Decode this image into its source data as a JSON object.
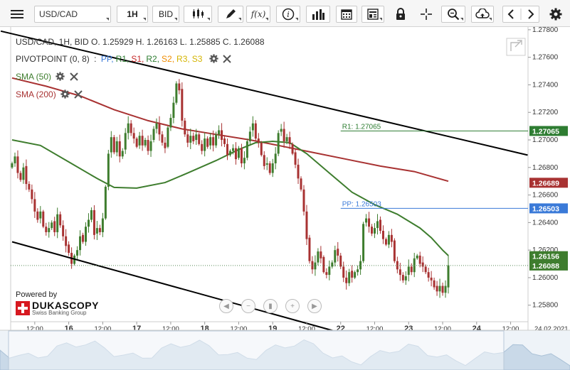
{
  "toolbar": {
    "symbol": "USD/CAD",
    "interval": "1H",
    "side": "BID",
    "fx_label": "f(x)",
    "buttons": [
      "menu-icon",
      "candle-type-icon",
      "draw-pen-icon",
      "function-icon",
      "info-icon",
      "bar-chart-icon",
      "calendar-icon",
      "news-icon",
      "lock-icon",
      "crosshair-icon",
      "zoom-icon",
      "upload-icon",
      "arrow-left-icon",
      "arrow-right-icon",
      "gear-icon"
    ]
  },
  "legend": {
    "ohlc": "USD/CAD, 1H, BID   O. 1.25929 H. 1.26163 L. 1.25885 C. 1.26088",
    "pivot": {
      "name": "PIVOTPOINT (0, 8)",
      "colon": ":",
      "items": [
        {
          "label": "PP",
          "color": "#3a7ad8"
        },
        {
          "label": "R1",
          "color": "#2e7d32"
        },
        {
          "label": "S1",
          "color": "#c62828"
        },
        {
          "label": "R2",
          "color": "#2e7d32"
        },
        {
          "label": "S2",
          "color": "#f08c00"
        },
        {
          "label": "R3",
          "color": "#d4b400"
        },
        {
          "label": "S3",
          "color": "#d4b400"
        }
      ]
    },
    "sma50": {
      "label": "SMA (50)",
      "color": "#3e7d2e"
    },
    "sma200": {
      "label": "SMA (200)",
      "color": "#a83232"
    }
  },
  "branding": {
    "powered_by": "Powered by",
    "name": "DUKASCOPY",
    "tagline": "Swiss Banking Group"
  },
  "chart_data": {
    "type": "candlestick",
    "instrument": "USD/CAD",
    "timeframe": "1H",
    "ohlc_last": {
      "open": 1.25929,
      "high": 1.26163,
      "low": 1.25885,
      "close": 1.26088
    },
    "ylim": [
      1.2568,
      1.2782
    ],
    "y_ticks": [
      "1.27800",
      "1.27600",
      "1.27400",
      "1.27200",
      "1.27000",
      "1.26800",
      "1.26600",
      "1.26400",
      "1.26200",
      "1.26000",
      "1.25800"
    ],
    "x_ticks": [
      {
        "label": "12:00",
        "bar": 8
      },
      {
        "label": "16",
        "bar": 20
      },
      {
        "label": "12:00",
        "bar": 32
      },
      {
        "label": "17",
        "bar": 44
      },
      {
        "label": "12:00",
        "bar": 56
      },
      {
        "label": "18",
        "bar": 68
      },
      {
        "label": "12:00",
        "bar": 80
      },
      {
        "label": "19",
        "bar": 92
      },
      {
        "label": "12:00",
        "bar": 104
      },
      {
        "label": "22",
        "bar": 116
      },
      {
        "label": "12:00",
        "bar": 128
      },
      {
        "label": "23",
        "bar": 140
      },
      {
        "label": "12:00",
        "bar": 152
      },
      {
        "label": "24",
        "bar": 164
      },
      {
        "label": "12:00",
        "bar": 176
      }
    ],
    "x_end_label": "24.02.2021",
    "closes": [
      1.2683,
      1.2688,
      1.2676,
      1.2671,
      1.268,
      1.2668,
      1.2664,
      1.2657,
      1.2648,
      1.2642,
      1.2648,
      1.2637,
      1.2633,
      1.2636,
      1.264,
      1.2633,
      1.2646,
      1.2638,
      1.263,
      1.2623,
      1.2618,
      1.261,
      1.2616,
      1.262,
      1.263,
      1.2626,
      1.2637,
      1.2642,
      1.2649,
      1.2631,
      1.2636,
      1.2633,
      1.2643,
      1.2666,
      1.269,
      1.2702,
      1.2691,
      1.2699,
      1.2688,
      1.2692,
      1.2705,
      1.2712,
      1.2705,
      1.2701,
      1.2695,
      1.2703,
      1.2696,
      1.27,
      1.2692,
      1.2699,
      1.2708,
      1.2712,
      1.2704,
      1.2698,
      1.2694,
      1.2709,
      1.2716,
      1.2727,
      1.2741,
      1.2736,
      1.2714,
      1.2704,
      1.2698,
      1.2703,
      1.2699,
      1.2704,
      1.2697,
      1.2692,
      1.2701,
      1.2695,
      1.2702,
      1.2696,
      1.2704,
      1.2707,
      1.27,
      1.2697,
      1.2689,
      1.2692,
      1.2694,
      1.2686,
      1.2694,
      1.2683,
      1.2687,
      1.2699,
      1.2706,
      1.2712,
      1.2701,
      1.2698,
      1.2689,
      1.2681,
      1.2683,
      1.2676,
      1.2683,
      1.269,
      1.2705,
      1.2708,
      1.2699,
      1.2702,
      1.2697,
      1.269,
      1.2682,
      1.2672,
      1.2664,
      1.2648,
      1.2628,
      1.2612,
      1.2606,
      1.2611,
      1.2619,
      1.2614,
      1.2604,
      1.2602,
      1.2608,
      1.2611,
      1.262,
      1.2616,
      1.2608,
      1.26,
      1.2596,
      1.2604,
      1.26,
      1.2604,
      1.2606,
      1.2612,
      1.2639,
      1.2643,
      1.2637,
      1.2632,
      1.2636,
      1.2641,
      1.2634,
      1.2628,
      1.2624,
      1.2631,
      1.2626,
      1.2612,
      1.2606,
      1.2602,
      1.2598,
      1.2601,
      1.2608,
      1.2604,
      1.2614,
      1.2616,
      1.261,
      1.2608,
      1.2604,
      1.26,
      1.2598,
      1.2593,
      1.259,
      1.2594,
      1.2589,
      1.2594,
      1.2609
    ],
    "sma50": [
      [
        0,
        1.27
      ],
      [
        10,
        1.2696
      ],
      [
        20,
        1.2684
      ],
      [
        30,
        1.2672
      ],
      [
        36,
        1.26655
      ],
      [
        44,
        1.2665
      ],
      [
        54,
        1.2669
      ],
      [
        62,
        1.2676
      ],
      [
        72,
        1.2685
      ],
      [
        80,
        1.2693
      ],
      [
        86,
        1.2698
      ],
      [
        92,
        1.2699
      ],
      [
        98,
        1.2698
      ],
      [
        104,
        1.269
      ],
      [
        112,
        1.2676
      ],
      [
        120,
        1.2662
      ],
      [
        128,
        1.2653
      ],
      [
        136,
        1.2646
      ],
      [
        144,
        1.2636
      ],
      [
        148,
        1.2629
      ],
      [
        152,
        1.262
      ],
      [
        154,
        1.2616
      ]
    ],
    "sma200": [
      [
        0,
        1.2745
      ],
      [
        12,
        1.2739
      ],
      [
        24,
        1.2732
      ],
      [
        36,
        1.2722
      ],
      [
        48,
        1.2714
      ],
      [
        60,
        1.2708
      ],
      [
        72,
        1.2704
      ],
      [
        84,
        1.27
      ],
      [
        94,
        1.2696
      ],
      [
        106,
        1.2691
      ],
      [
        118,
        1.2686
      ],
      [
        130,
        1.2681
      ],
      [
        142,
        1.2677
      ],
      [
        154,
        1.267
      ]
    ],
    "channel_upper": {
      "from": {
        "bar": -4,
        "y": 1.2779
      },
      "to": {
        "bar": 182,
        "y": 1.2689
      }
    },
    "channel_lower": {
      "from": {
        "bar": 0,
        "y": 1.2626
      },
      "to": {
        "bar": 130,
        "y": 1.2552
      }
    },
    "pivot_levels": [
      {
        "name": "R1",
        "label": "R1: 1.27065",
        "value": 1.27065,
        "tag": "1.27065",
        "color": "#2e7d32",
        "start_bar": 116
      },
      {
        "name": "PP",
        "label": "PP: 1.26503",
        "value": 1.26503,
        "tag": "1.26503",
        "color": "#3a7ad8",
        "start_bar": 116
      }
    ],
    "price_tags": [
      {
        "value": 1.26689,
        "text": "1.26689",
        "color": "#a83232"
      },
      {
        "value": 1.26156,
        "text": "1.26156",
        "color": "#3e7d2e"
      },
      {
        "value": 1.26088,
        "text": "1.26088",
        "color": "#3e7d2e"
      }
    ],
    "current_price": 1.26088,
    "bull_color": "#3e7d2e",
    "bear_color": "#a83232"
  }
}
